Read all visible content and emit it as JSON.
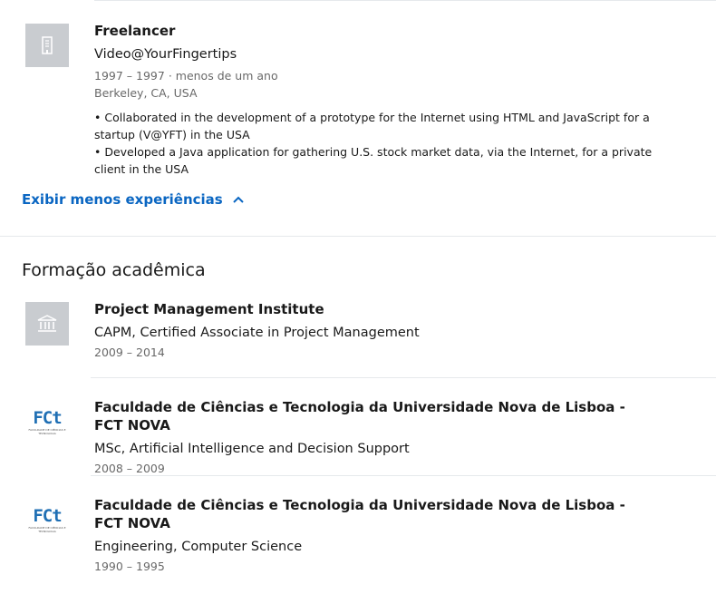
{
  "experience": {
    "title": "Freelancer",
    "company": "Video@YourFingertips",
    "dates": "1997 – 1997",
    "duration": "menos de um ano",
    "location": "Berkeley, CA, USA",
    "bullets": [
      "• Collaborated in the development of a prototype for the Internet using HTML and JavaScript for a startup (V@YFT) in the USA",
      "• Developed a Java application for gathering U.S. stock market data, via the Internet, for a private client in the USA"
    ],
    "show_less_label": "Exibir menos experiências"
  },
  "education": {
    "section_title": "Formação acadêmica",
    "items": [
      {
        "school": "Project Management Institute",
        "degree": "CAPM, Certified Associate in Project Management",
        "dates": "2009 – 2014"
      },
      {
        "school": "Faculdade de Ciências e Tecnologia da Universidade Nova de Lisboa - FCT NOVA",
        "degree": "MSc, Artificial Intelligence and Decision Support",
        "dates": "2008 – 2009"
      },
      {
        "school": "Faculdade de Ciências e Tecnologia da Universidade Nova de Lisboa - FCT NOVA",
        "degree": "Engineering, Computer Science",
        "dates": "1990 – 1995"
      }
    ],
    "fct_logo_text": "FCt",
    "fct_logo_subtext": "FACULDADE DE CIÊNCIAS E TECNOLOGIA"
  },
  "colors": {
    "link": "#0a66c2",
    "placeholder_logo": "#c9ccd0",
    "fct_blue": "#1f6fb4",
    "fct_green": "#6fb43f"
  }
}
